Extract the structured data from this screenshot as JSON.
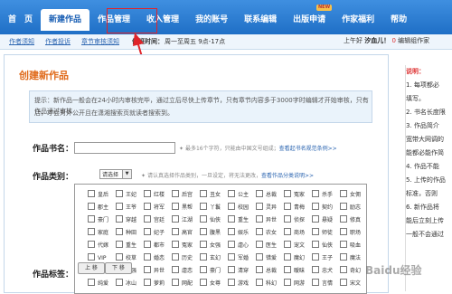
{
  "nav": {
    "items": [
      {
        "label": "首　页",
        "active": false
      },
      {
        "label": "新建作品",
        "active": true
      },
      {
        "label": "作品管理",
        "active": false
      },
      {
        "label": "收入管理",
        "active": false
      },
      {
        "label": "我的账号",
        "active": false
      },
      {
        "label": "联系编辑",
        "active": false
      },
      {
        "label": "出版申请",
        "active": false,
        "badge": "NEW"
      },
      {
        "label": "作家福利",
        "active": false
      },
      {
        "label": "帮助",
        "active": false
      }
    ]
  },
  "subbar": {
    "link1": "作者须知",
    "link2": "作者投诉",
    "link3": "章节审核须知",
    "time_label": "值班时间：",
    "time_value": "周一至周五 9点-17点"
  },
  "user": {
    "greeting": "上午好",
    "name": "汐血儿！",
    "count": "0",
    "msg": "编辑组作家"
  },
  "panel": {
    "title": "创建新作品"
  },
  "tip": {
    "line1": "提示：新作品一般会在24小时内审核完毕，通过立后尽快上传章节，只有章节内容多于3000字时编辑才开始审核，只有作品通过审核",
    "line2": "后，才会对外公开且在潇湘搜索页就读者搜索到。"
  },
  "form": {
    "bookname_label": "作品书名：",
    "bookname_hint": "最多16个字符，只能由中国文号组成；",
    "bookname_link": "查看起书名规范条例>>",
    "category_label": "作品类别：",
    "category_selected": "请选择",
    "category_hint": "请认真选择作品类别，一旦设定，将无法更改，",
    "category_link": "查看作品分类说明>>",
    "tags_label": "作品标签：",
    "btn_up": "上 移",
    "btn_down": "下 移"
  },
  "tags": [
    [
      "皇后",
      "王妃",
      "红楼",
      "后宫",
      "丑女",
      "公主",
      "总裁",
      "冤家",
      "杀手",
      "女佣"
    ],
    [
      "郡主",
      "王爷",
      "将军",
      "黑帮",
      "丫鬟",
      "校园",
      "灵异",
      "青梅",
      "契约",
      "励志"
    ],
    [
      "豪门",
      "穿越",
      "宫廷",
      "江湖",
      "仙侠",
      "重生",
      "异世",
      "侦探",
      "悬疑",
      "修真"
    ],
    [
      "家庭",
      "种田",
      "妃子",
      "高官",
      "腹黑",
      "娱乐",
      "农女",
      "商场",
      "师徒",
      "职场"
    ],
    [
      "代嫁",
      "重生",
      "都市",
      "冤家",
      "女强",
      "虐心",
      "医生",
      "宠文",
      "仙侠",
      "吸血"
    ],
    [
      "VIP",
      "校草",
      "婚恋",
      "历史",
      "玄幻",
      "军婚",
      "错爱",
      "魔幻",
      "王子",
      "魔法"
    ],
    [
      "免费",
      "女强",
      "异世",
      "虐恋",
      "豪门",
      "清穿",
      "总裁",
      "暧昧",
      "忠犬",
      "奇幻"
    ],
    [
      "纯爱",
      "冰山",
      "萝莉",
      "网配",
      "女尊",
      "游戏",
      "科幻",
      "网游",
      "言情",
      "宋文"
    ]
  ],
  "sidebar": {
    "heading": "说明：",
    "lines": [
      "1. 每项都必",
      "填写。",
      "2. 书名长度限",
      "3. 作品简介",
      "宽带大网调的",
      "能都必能作简",
      "4. 作品不能",
      "5. 上传的作品",
      "标准，否则",
      "6. 新作品将",
      "能后立刻上传",
      "一般不会通过"
    ]
  },
  "watermark": "Baidu经验"
}
